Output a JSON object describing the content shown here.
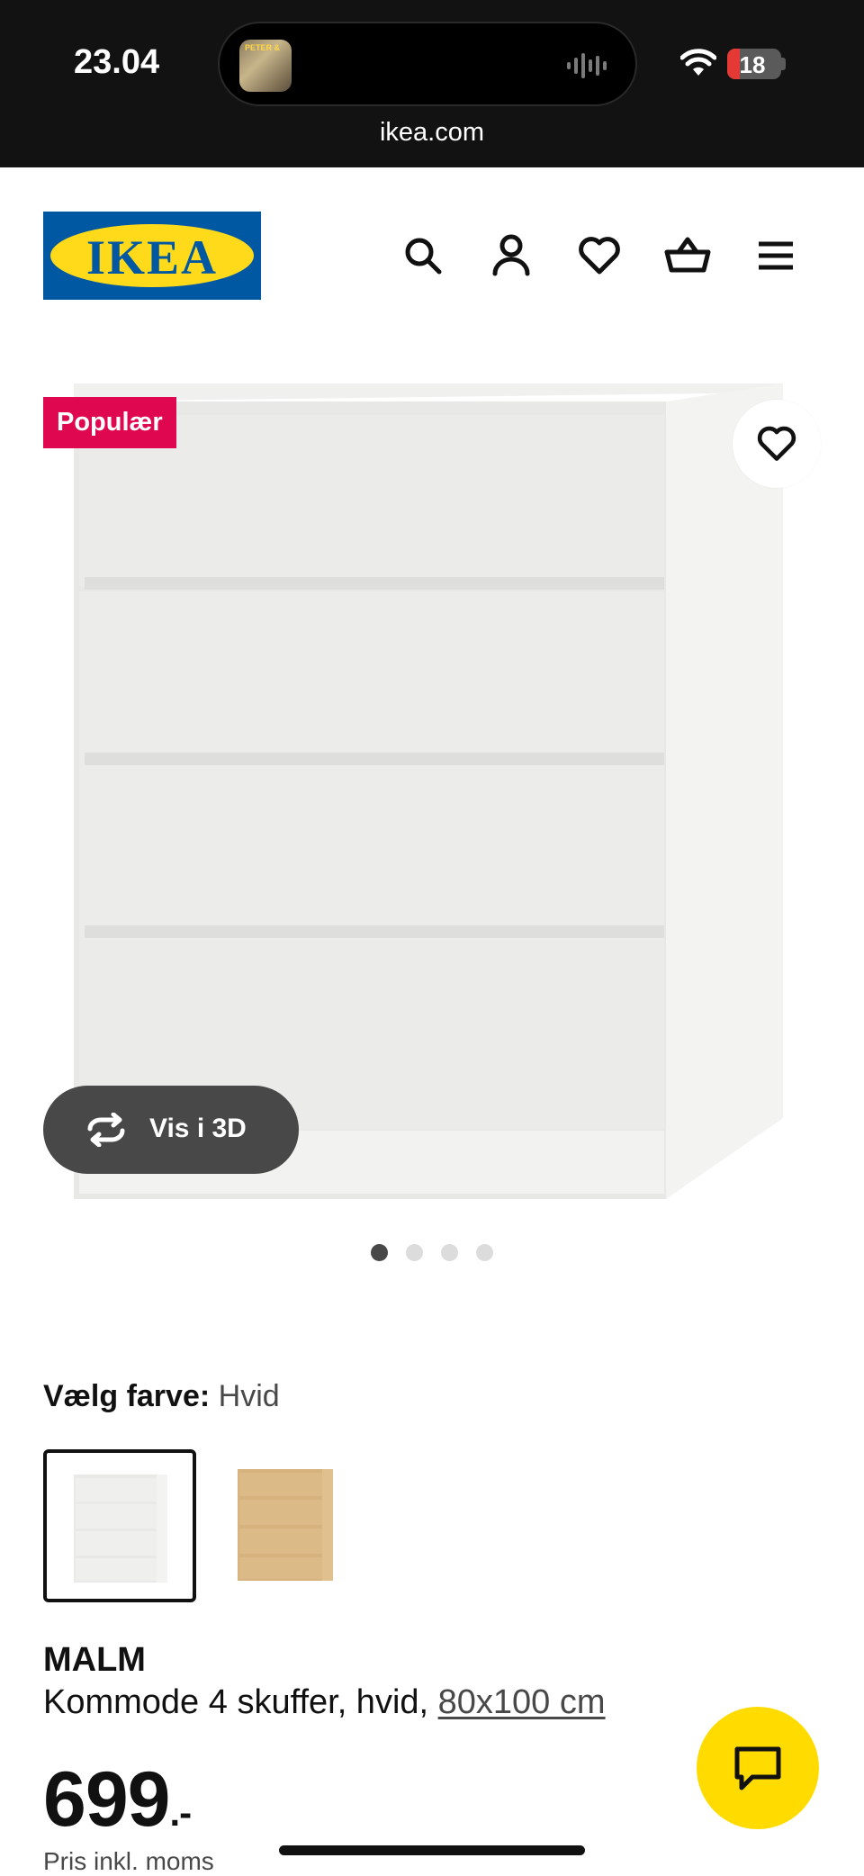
{
  "status_bar": {
    "time": "23.04",
    "battery": "18",
    "island_thumb_text": "PETER &"
  },
  "browser": {
    "url": "ikea.com"
  },
  "header": {
    "logo_text": "IKEA",
    "icons": [
      "search-icon",
      "account-icon",
      "heart-icon",
      "basket-icon",
      "menu-icon"
    ]
  },
  "gallery": {
    "badge": "Populær",
    "view_3d_label": "Vis i 3D",
    "page_count": 4,
    "active_page": 1
  },
  "color_selector": {
    "label": "Vælg farve:",
    "value": "Hvid",
    "options": [
      "Hvid",
      "Eg"
    ],
    "selected": 0
  },
  "product": {
    "name": "MALM",
    "description": "Kommode 4 skuffer, hvid, ",
    "size_link": "80x100 cm",
    "price": "699",
    "price_suffix": ".-",
    "price_note": "Pris inkl. moms"
  },
  "colors": {
    "ikea_blue": "#0058a3",
    "ikea_yellow": "#ffda1a",
    "badge_red": "#e00751",
    "chat_yellow": "#ffdb00"
  }
}
